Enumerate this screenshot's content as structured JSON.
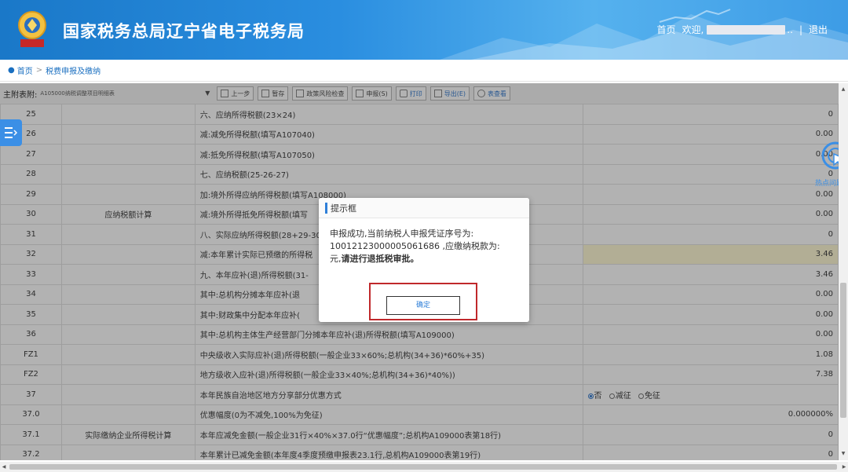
{
  "header": {
    "title": "国家税务总局辽宁省电子税务局",
    "nav_home": "首页",
    "welcome": "欢迎,",
    "user_suffix": "..",
    "logout": "退出"
  },
  "breadcrumb": {
    "home": "首页",
    "separator": ">",
    "current": "税费申报及缴纳"
  },
  "toolbar": {
    "label": "主附表附:",
    "select_value": "A105000纳税调整项目明细表",
    "buttons": [
      "上一步",
      "暂存",
      "政策风险检查",
      "申报(S)",
      "打印",
      "导出(E)",
      "表查看"
    ]
  },
  "table": {
    "rows": [
      {
        "no": "25",
        "cat": "",
        "item": "六、应纳所得税额(23×24)",
        "value": "0"
      },
      {
        "no": "26",
        "cat": "",
        "item": "减:减免所得税额(填写A107040)",
        "value": "0.00"
      },
      {
        "no": "27",
        "cat": "",
        "item": "减:抵免所得税额(填写A107050)",
        "value": "0.00"
      },
      {
        "no": "28",
        "cat": "",
        "item": "七、应纳税额(25-26-27)",
        "value": "0"
      },
      {
        "no": "29",
        "cat": "",
        "item": "加:境外所得应纳所得税额(填写A108000)",
        "value": "0.00"
      },
      {
        "no": "30",
        "cat": "应纳税额计算",
        "item": "减:境外所得抵免所得税额(填写",
        "value": "0.00"
      },
      {
        "no": "31",
        "cat": "",
        "item": "八、实际应纳所得税额(28+29-30",
        "value": "0"
      },
      {
        "no": "32",
        "cat": "",
        "item": "减:本年累计实际已预缴的所得税",
        "value": "3.46"
      },
      {
        "no": "33",
        "cat": "",
        "item": "九、本年应补(退)所得税额(31-",
        "value": "3.46"
      },
      {
        "no": "34",
        "cat": "",
        "item": "其中:总机构分摊本年应补(退",
        "value": "0.00"
      },
      {
        "no": "35",
        "cat": "",
        "item": "其中:财政集中分配本年应补(",
        "value": "0.00"
      },
      {
        "no": "36",
        "cat": "",
        "item": "其中:总机构主体生产经营部门分摊本年应补(退)所得税额(填写A109000)",
        "value": "0.00"
      },
      {
        "no": "FZ1",
        "cat": "",
        "item": "中央级收入实际应补(退)所得税额(一般企业33×60%;总机构(34+36)*60%+35)",
        "value": "1.08"
      },
      {
        "no": "FZ2",
        "cat": "",
        "item": "地方级收入应补(退)所得税额(一般企业33×40%;总机构(34+36)*40%))",
        "value": "7.38"
      },
      {
        "no": "37",
        "cat": "",
        "item": "本年民族自治地区地方分享部分优惠方式",
        "value": ""
      },
      {
        "no": "37.0",
        "cat": "",
        "item": "优惠幅度(0为不减免,100%为免征)",
        "value": "0.000000%"
      },
      {
        "no": "37.1",
        "cat": "实际缴纳企业所得税计算",
        "item": "本年应减免金额(一般企业31行×40%×37.0行“优惠幅度”;总机构A109000表第18行)",
        "value": "0"
      },
      {
        "no": "37.2",
        "cat": "",
        "item": "本年累计已减免金额(本年度4季度预缴申报表23.1行,总机构A109000表第19行)",
        "value": "0"
      }
    ],
    "radio_options": [
      "否",
      "减征",
      "免征"
    ]
  },
  "hotspot": {
    "label": "热点问题"
  },
  "modal": {
    "title": "提示框",
    "msg_line1": "申报成功,当前纳税人申报凭证序号为:",
    "msg_line2": "10012123000005061686 ,应缴纳税款为:",
    "msg_line3a": "元,",
    "msg_line3b": "请进行退抵税审批。",
    "ok_label": "确定"
  },
  "colors": {
    "header_blue": "#2a8ee0",
    "accent_blue": "#2f7fd8",
    "highlight_red": "#c0282b"
  }
}
